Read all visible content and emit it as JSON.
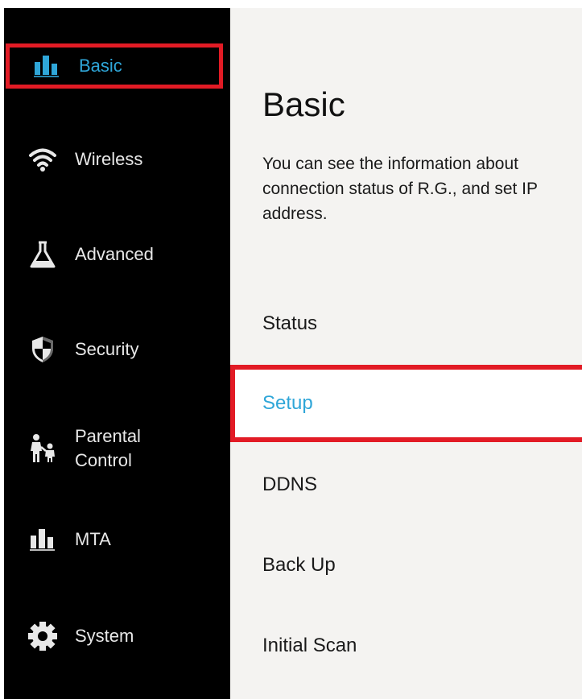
{
  "sidebar": {
    "items": [
      {
        "id": "basic",
        "label": "Basic",
        "icon": "bar-chart-icon",
        "active": true
      },
      {
        "id": "wireless",
        "label": "Wireless",
        "icon": "wifi-icon",
        "active": false
      },
      {
        "id": "advanced",
        "label": "Advanced",
        "icon": "flask-icon",
        "active": false
      },
      {
        "id": "security",
        "label": "Security",
        "icon": "shield-icon",
        "active": false
      },
      {
        "id": "parental",
        "label": "Parental\nControl",
        "icon": "family-icon",
        "active": false
      },
      {
        "id": "mta",
        "label": "MTA",
        "icon": "bar-chart-icon",
        "active": false
      },
      {
        "id": "system",
        "label": "System",
        "icon": "gear-icon",
        "active": false
      }
    ]
  },
  "main": {
    "title": "Basic",
    "description": "You can see the information about connection status of R.G., and set IP address.",
    "menu": [
      {
        "label": "Status",
        "selected": false
      },
      {
        "label": "Setup",
        "selected": true
      },
      {
        "label": "DDNS",
        "selected": false
      },
      {
        "label": "Back Up",
        "selected": false
      },
      {
        "label": "Initial Scan",
        "selected": false
      }
    ]
  },
  "colors": {
    "accent": "#2fa6d8",
    "highlight": "#e21b25",
    "sidebar_bg": "#000000",
    "content_bg": "#f4f3f1"
  }
}
